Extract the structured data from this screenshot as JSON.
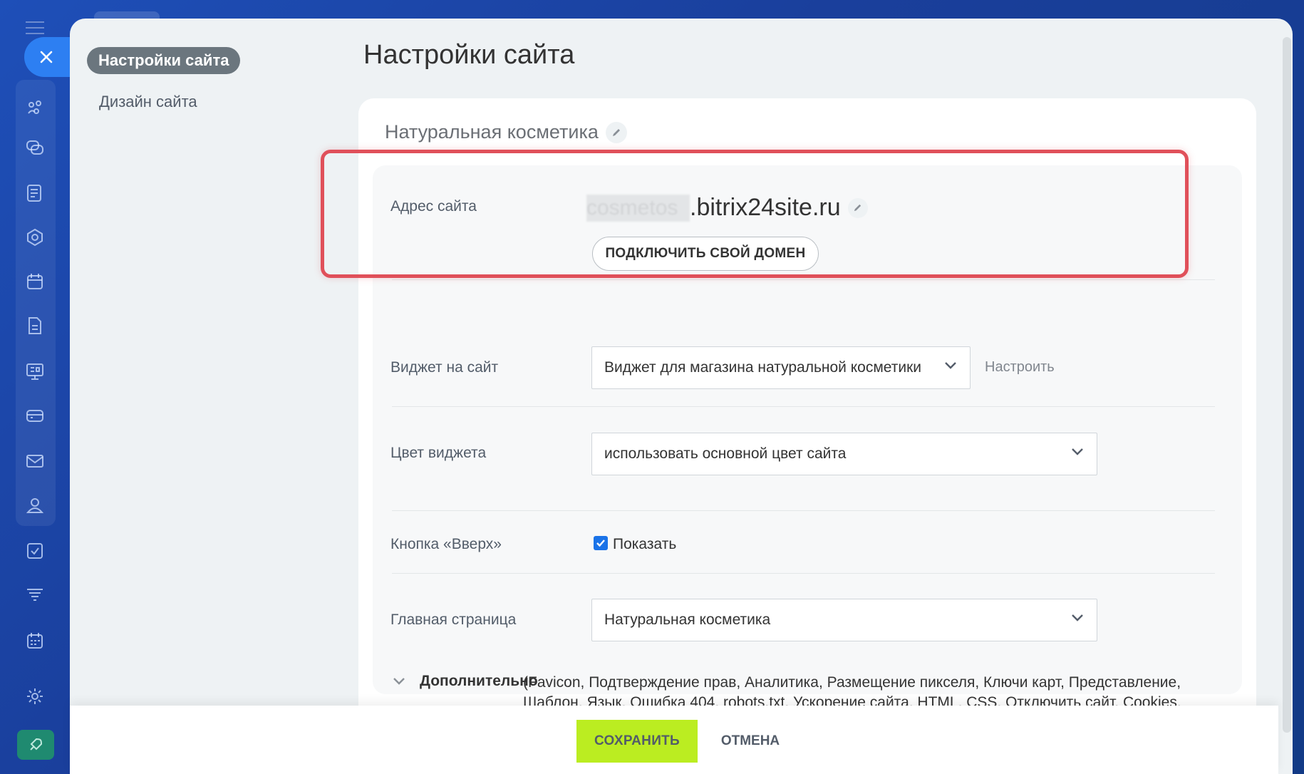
{
  "sidebar": {
    "active_item": "Настройки сайта",
    "items": [
      {
        "label": "Дизайн сайта"
      }
    ]
  },
  "page": {
    "title": "Настройки сайта"
  },
  "site": {
    "name": "Натуральная косметика",
    "address_label": "Адрес сайта",
    "subdomain_blurred": "cosmetos",
    "domain_suffix": ".bitrix24site.ru",
    "connect_domain_label": "ПОДКЛЮЧИТЬ СВОЙ ДОМЕН"
  },
  "widget": {
    "label": "Виджет на сайт",
    "value": "Виджет для магазина натуральной косметики",
    "setup_link": "Настроить"
  },
  "widget_color": {
    "label": "Цвет виджета",
    "value": "использовать основной цвет сайта"
  },
  "up_button": {
    "label": "Кнопка «Вверх»",
    "checkbox_label": "Показать",
    "checked": true
  },
  "home_page": {
    "label": "Главная страница",
    "value": "Натуральная косметика"
  },
  "additional": {
    "title": "Дополнительно",
    "list": "(Favicon,  Подтверждение прав,  Аналитика,  Размещение пикселя,  Ключи карт,  Представление,  Шаблон,  Язык,  Ошибка 404,  robots.txt,  Ускорение сайта,  HTML,  CSS,  Отключить сайт,  Cookies,  Подписи)"
  },
  "footer": {
    "save_label": "СОХРАНИТЬ",
    "cancel_label": "ОТМЕНА"
  },
  "colors": {
    "highlight": "#e0505a",
    "save_button": "#bbed21",
    "close_button": "#2d7ff2",
    "checkbox": "#1a73e8"
  },
  "icons": [
    "menu-icon",
    "close-icon",
    "crm-icon",
    "chat-icon",
    "feed-icon",
    "hexagon-icon",
    "calendar-icon",
    "document-icon",
    "presentation-icon",
    "card-icon",
    "mail-icon",
    "contacts-icon",
    "tasks-icon",
    "filter-icon",
    "schedule-icon",
    "settings-icon",
    "rocket-icon",
    "pencil-icon",
    "chevron-down-icon"
  ]
}
